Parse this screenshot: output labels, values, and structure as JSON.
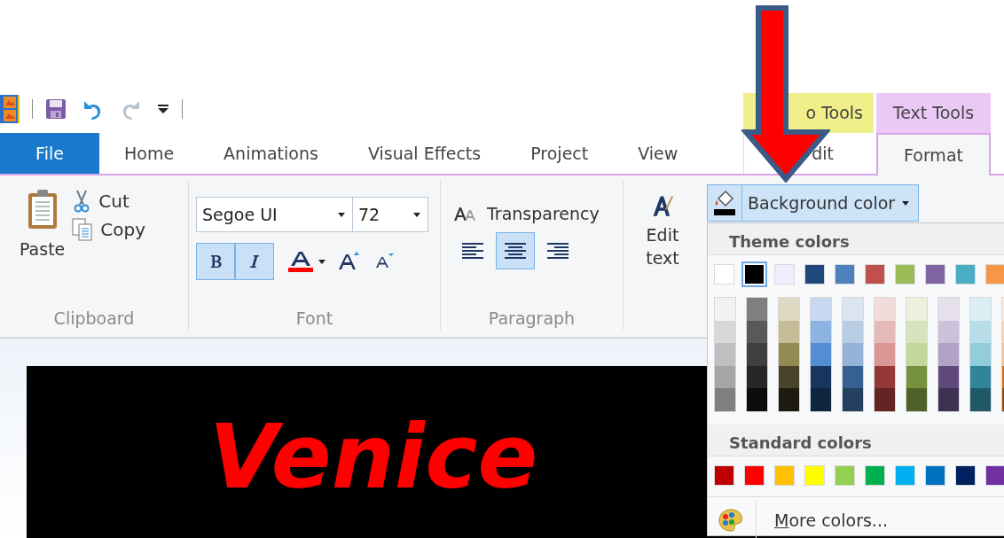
{
  "contextual_groups": [
    {
      "label": "o Tools",
      "color": "#f0ef8a"
    },
    {
      "label": "Text Tools",
      "color": "#ebc9f7"
    }
  ],
  "tabs": [
    {
      "label": "File",
      "kind": "file",
      "selected": false
    },
    {
      "label": "Home",
      "kind": "normal",
      "selected": false
    },
    {
      "label": "Animations",
      "kind": "normal",
      "selected": false
    },
    {
      "label": "Visual Effects",
      "kind": "normal",
      "selected": false
    },
    {
      "label": "Project",
      "kind": "normal",
      "selected": false
    },
    {
      "label": "View",
      "kind": "normal",
      "selected": false
    },
    {
      "label": "dit",
      "kind": "contextual",
      "selected": false
    },
    {
      "label": "Format",
      "kind": "contextual",
      "selected": true
    }
  ],
  "ribbon": {
    "clipboard": {
      "paste": "Paste",
      "cut": "Cut",
      "copy": "Copy",
      "label": "Clipboard"
    },
    "font": {
      "font_name": "Segoe UI",
      "font_size": "72",
      "bold": true,
      "italic": true,
      "label": "Font"
    },
    "paragraph": {
      "transparency": "Transparency",
      "alignments": [
        {
          "kind": "left",
          "selected": false
        },
        {
          "kind": "center",
          "selected": true
        },
        {
          "kind": "right",
          "selected": false
        }
      ],
      "label": "Paragraph"
    },
    "edit_text": "Edit text",
    "background_color": {
      "label": "Background color",
      "color": "#000000"
    }
  },
  "dropdown": {
    "theme_heading": "Theme colors",
    "theme_row": [
      {
        "color": "#ffffff",
        "selected": false
      },
      {
        "color": "#000000",
        "selected": true
      },
      {
        "color": "#eeeeff",
        "selected": false
      },
      {
        "color": "#1f497d",
        "selected": false
      },
      {
        "color": "#4f81bd",
        "selected": false
      },
      {
        "color": "#c0504d",
        "selected": false
      },
      {
        "color": "#9bbb59",
        "selected": false
      },
      {
        "color": "#8064a2",
        "selected": false
      },
      {
        "color": "#4bacc6",
        "selected": false
      },
      {
        "color": "#f79646",
        "selected": false
      }
    ],
    "shade_columns": [
      [
        {
          "color": "#f2f2f2"
        },
        {
          "color": "#d8d8d8"
        },
        {
          "color": "#bfbfbf"
        },
        {
          "color": "#a5a5a5"
        },
        {
          "color": "#7f7f7f"
        }
      ],
      [
        {
          "color": "#7f7f7f"
        },
        {
          "color": "#595959"
        },
        {
          "color": "#3f3f3f"
        },
        {
          "color": "#262626"
        },
        {
          "color": "#0c0c0c"
        }
      ],
      [
        {
          "color": "#ddd9c3"
        },
        {
          "color": "#c4bd97"
        },
        {
          "color": "#938953"
        },
        {
          "color": "#494429"
        },
        {
          "color": "#1d1b10"
        }
      ],
      [
        {
          "color": "#c6d9f0"
        },
        {
          "color": "#8db3e2"
        },
        {
          "color": "#548dd4"
        },
        {
          "color": "#17365d"
        },
        {
          "color": "#0f243e"
        }
      ],
      [
        {
          "color": "#dbe5f1"
        },
        {
          "color": "#b8cce4"
        },
        {
          "color": "#95b3d7"
        },
        {
          "color": "#366092"
        },
        {
          "color": "#244061"
        }
      ],
      [
        {
          "color": "#f2dcdb"
        },
        {
          "color": "#e5b9b7"
        },
        {
          "color": "#d99694"
        },
        {
          "color": "#953734"
        },
        {
          "color": "#632423"
        }
      ],
      [
        {
          "color": "#ebf1dd"
        },
        {
          "color": "#d7e3bc"
        },
        {
          "color": "#c3d69b"
        },
        {
          "color": "#76923c"
        },
        {
          "color": "#4f6128"
        }
      ],
      [
        {
          "color": "#e5e0ec"
        },
        {
          "color": "#ccc1d9"
        },
        {
          "color": "#b2a2c7"
        },
        {
          "color": "#5f497a"
        },
        {
          "color": "#3f3151"
        }
      ],
      [
        {
          "color": "#dbeef3"
        },
        {
          "color": "#b7dde8"
        },
        {
          "color": "#92cddc"
        },
        {
          "color": "#31859b"
        },
        {
          "color": "#205867"
        }
      ],
      [
        {
          "color": "#fdeada"
        },
        {
          "color": "#fbd5b5"
        },
        {
          "color": "#fac08f"
        },
        {
          "color": "#e36c09"
        },
        {
          "color": "#974806"
        }
      ]
    ],
    "standard_heading": "Standard colors",
    "standard_row": [
      {
        "color": "#c00000"
      },
      {
        "color": "#ff0000"
      },
      {
        "color": "#ffc000"
      },
      {
        "color": "#ffff00"
      },
      {
        "color": "#92d050"
      },
      {
        "color": "#00b050"
      },
      {
        "color": "#00b0f0"
      },
      {
        "color": "#0070c0"
      },
      {
        "color": "#002060"
      },
      {
        "color": "#7030a0"
      }
    ],
    "more_colors": "More colors..."
  },
  "preview": {
    "title_text": "Venice"
  }
}
